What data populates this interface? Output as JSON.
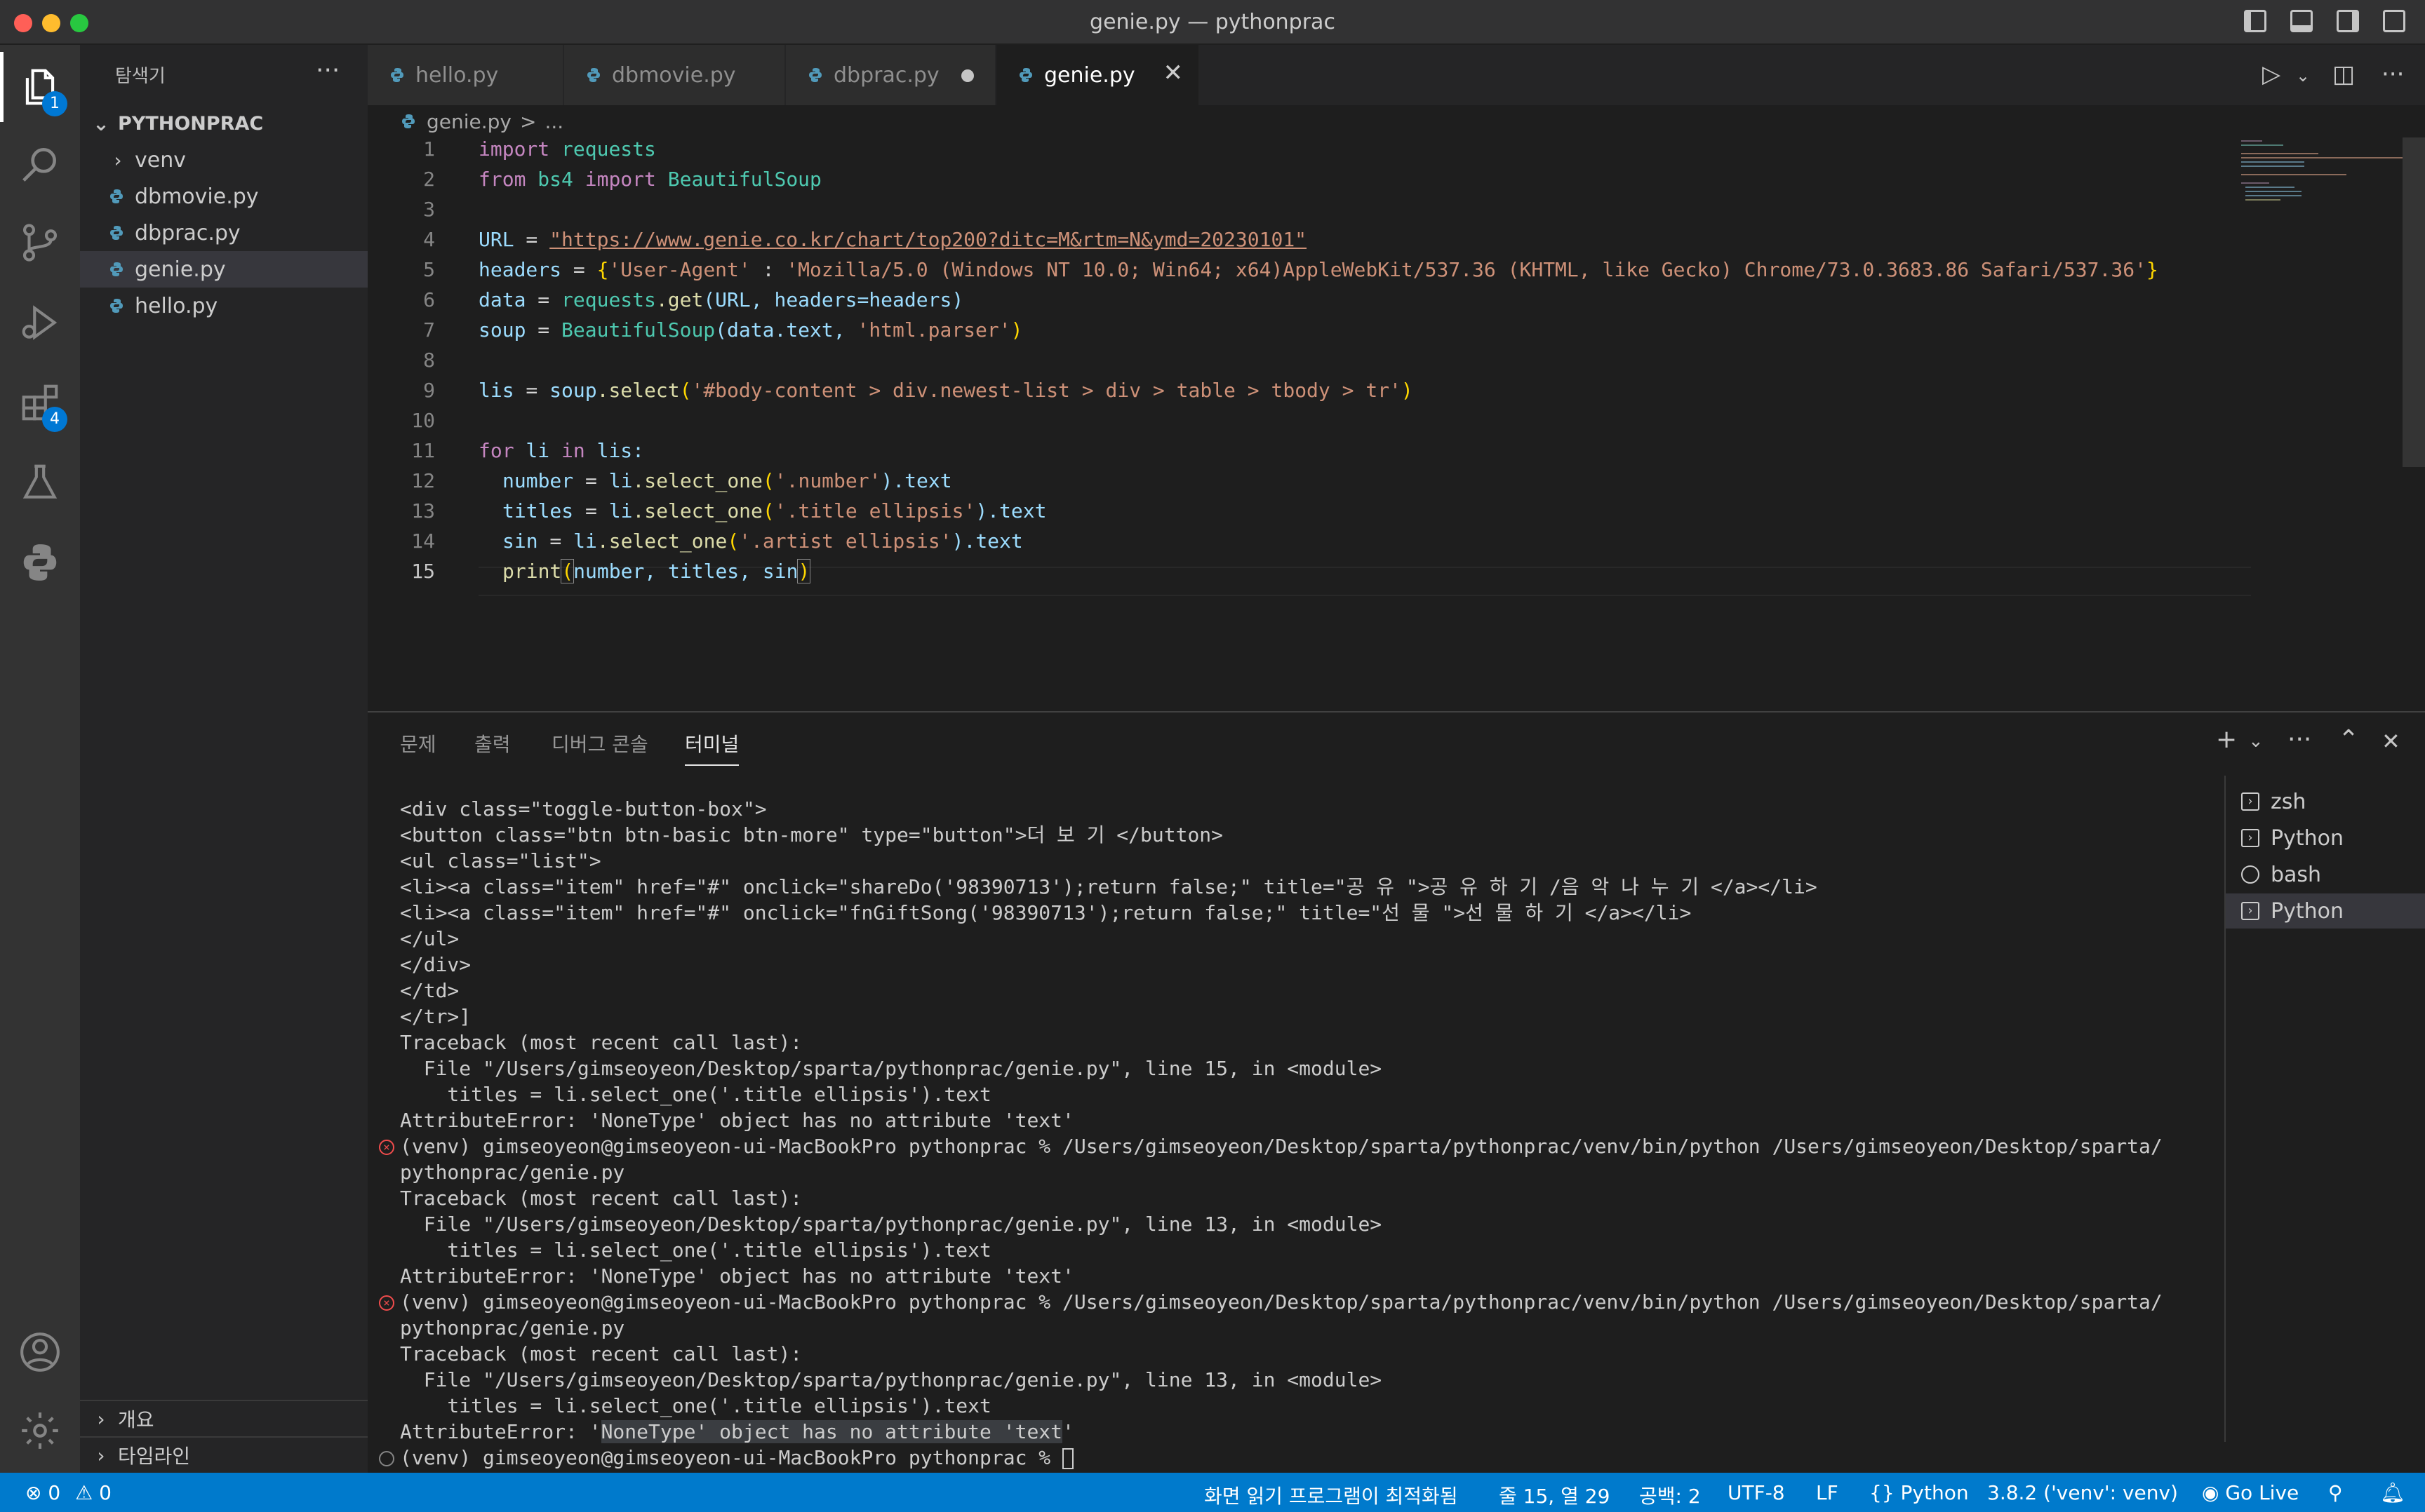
{
  "window": {
    "title": "genie.py — pythonprac"
  },
  "activity": {
    "explorer_badge": "1",
    "extensions_badge": "4"
  },
  "sidebar": {
    "header": "탐색기",
    "more": "···",
    "root": "PYTHONPRAC",
    "items": [
      {
        "label": "venv"
      },
      {
        "label": "dbmovie.py"
      },
      {
        "label": "dbprac.py"
      },
      {
        "label": "genie.py"
      },
      {
        "label": "hello.py"
      }
    ],
    "outline": "개요",
    "timeline": "타임라인"
  },
  "tabs": [
    {
      "label": "hello.py"
    },
    {
      "label": "dbmovie.py"
    },
    {
      "label": "dbprac.py"
    },
    {
      "label": "genie.py"
    }
  ],
  "breadcrumb": {
    "file": "genie.py",
    "sep": ">",
    "rest": "..."
  },
  "code": {
    "line_numbers": [
      "1",
      "2",
      "3",
      "4",
      "5",
      "6",
      "7",
      "8",
      "9",
      "10",
      "11",
      "12",
      "13",
      "14",
      "15"
    ],
    "l1": {
      "kw": "import",
      "mod": "requests"
    },
    "l2": {
      "kw1": "from",
      "mod": "bs4",
      "kw2": "import",
      "cls": "BeautifulSoup"
    },
    "l4": {
      "var": "URL",
      "eq": " = ",
      "str": "\"https://www.genie.co.kr/chart/top200?ditc=M&rtm=N&ymd=20230101\""
    },
    "l5": {
      "var": "headers",
      "eq": " = ",
      "ob": "{",
      "key": "'User-Agent'",
      "colon": " : ",
      "val": "'Mozilla/5.0 (Windows NT 10.0; Win64; x64)AppleWebKit/537.36 (KHTML, like Gecko) Chrome/73.0.3683.86 Safari/537.36'",
      "cb": "}"
    },
    "l6": {
      "var": "data",
      "eq": " = ",
      "mod": "requests",
      "fn": ".get",
      "args": "(URL, headers=headers)"
    },
    "l7": {
      "var": "soup",
      "eq": " = ",
      "cls": "BeautifulSoup",
      "a1": "(data.text, ",
      "str": "'html.parser'",
      "a2": ")"
    },
    "l9": {
      "var": "lis",
      "eq": " = ",
      "obj": "soup",
      "fn": ".select",
      "a1": "(",
      "str": "'#body-content > div.newest-list > div > table > tbody > tr'",
      "a2": ")"
    },
    "l11": {
      "kw1": "for",
      "v": " li ",
      "kw2": "in",
      "rest": " lis:"
    },
    "l12": {
      "var": "number",
      "eq": " = ",
      "obj": "li",
      "fn": ".select_one",
      "a1": "(",
      "str": "'.number'",
      "a2": ").text"
    },
    "l13": {
      "var": "titles",
      "eq": " = ",
      "obj": "li",
      "fn": ".select_one",
      "a1": "(",
      "str": "'.title ellipsis'",
      "a2": ").text"
    },
    "l14": {
      "var": "sin",
      "eq": " = ",
      "obj": "li",
      "fn": ".select_one",
      "a1": "(",
      "str": "'.artist ellipsis'",
      "a2": ").text"
    },
    "l15": {
      "fn": "print",
      "a1": "(",
      "args": "number, titles, sin",
      "a2": ")"
    }
  },
  "panel": {
    "tabs": [
      "문제",
      "출력",
      "디버그 콘솔",
      "터미널"
    ],
    "terminals": [
      "zsh",
      "Python",
      "bash",
      "Python"
    ],
    "lines": [
      "<div class=\"toggle-button-box\">",
      "<button class=\"btn btn-basic btn-more\" type=\"button\">더 보 기 </button>",
      "<ul class=\"list\">",
      "<li><a class=\"item\" href=\"#\" onclick=\"shareDo('98390713');return false;\" title=\"공 유 \">공 유 하 기 /음 악 나 누 기 </a></li>",
      "<li><a class=\"item\" href=\"#\" onclick=\"fnGiftSong('98390713');return false;\" title=\"선 물 \">선 물 하 기 </a></li>",
      "</ul>",
      "</div>",
      "</td>",
      "</tr>]",
      "Traceback (most recent call last):",
      "  File \"/Users/gimseoyeon/Desktop/sparta/pythonprac/genie.py\", line 15, in <module>",
      "    titles = li.select_one('.title ellipsis').text",
      "AttributeError: 'NoneType' object has no attribute 'text'",
      "(venv) gimseoyeon@gimseoyeon-ui-MacBookPro pythonprac % /Users/gimseoyeon/Desktop/sparta/pythonprac/venv/bin/python /Users/gimseoyeon/Desktop/sparta/",
      "pythonprac/genie.py",
      "Traceback (most recent call last):",
      "  File \"/Users/gimseoyeon/Desktop/sparta/pythonprac/genie.py\", line 13, in <module>",
      "    titles = li.select_one('.title ellipsis').text",
      "AttributeError: 'NoneType' object has no attribute 'text'",
      "(venv) gimseoyeon@gimseoyeon-ui-MacBookPro pythonprac % /Users/gimseoyeon/Desktop/sparta/pythonprac/venv/bin/python /Users/gimseoyeon/Desktop/sparta/",
      "pythonprac/genie.py",
      "Traceback (most recent call last):",
      "  File \"/Users/gimseoyeon/Desktop/sparta/pythonprac/genie.py\", line 13, in <module>",
      "    titles = li.select_one('.title ellipsis').text"
    ],
    "last_err_prefix": "AttributeError: '",
    "last_err_hl": "NoneType' object has no attribute 'text",
    "last_err_suffix": "'",
    "prompt": "(venv) gimseoyeon@gimseoyeon-ui-MacBookPro pythonprac % "
  },
  "status": {
    "errors": "0",
    "warnings": "0",
    "screen_reader": "화면 읽기 프로그램이 최적화됨",
    "position": "줄 15, 열 29",
    "spaces": "공백: 2",
    "encoding": "UTF-8",
    "eol": "LF",
    "language": "Python",
    "interpreter": "3.8.2 ('venv': venv)",
    "golive": "Go Live"
  },
  "colors": {
    "accent": "#007acc",
    "error": "#f14c4c",
    "badge": "#0078d4"
  }
}
